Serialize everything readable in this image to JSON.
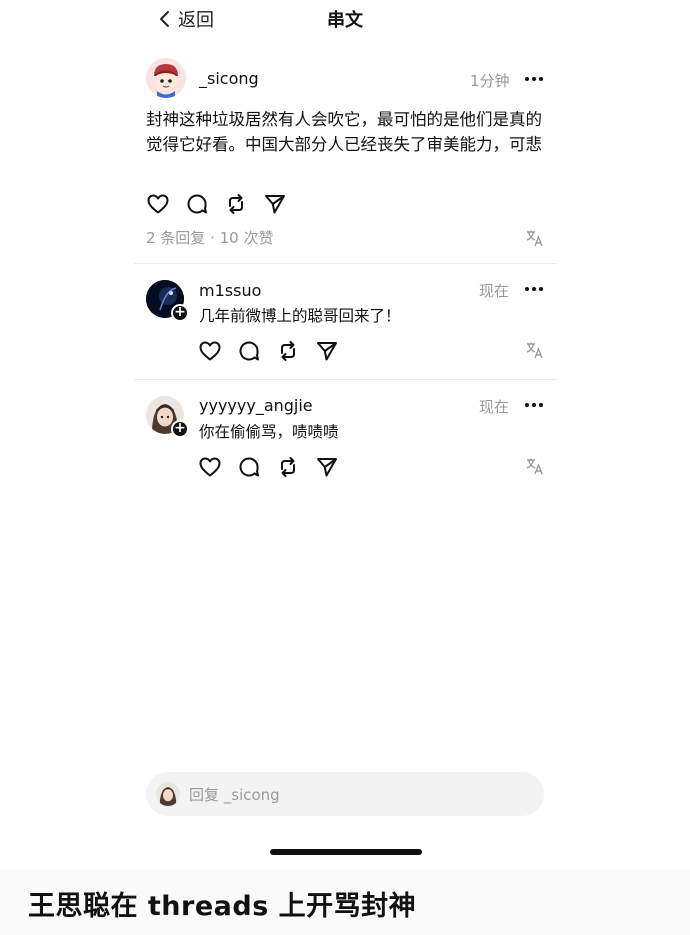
{
  "nav": {
    "back_label": "返回",
    "title": "串文"
  },
  "post": {
    "username": "_sicong",
    "time": "1分钟",
    "text": "封神这种垃圾居然有人会吹它，最可怕的是他们是真的觉得它好看。中国大部分人已经丧失了审美能力，可悲",
    "stats": "2 条回复 · 10 次赞"
  },
  "replies": [
    {
      "username": "m1ssuo",
      "time": "现在",
      "text": "几年前微博上的聪哥回来了！"
    },
    {
      "username": "yyyyyy_angjie",
      "time": "现在",
      "text": "你在偷偷骂，啧啧啧"
    }
  ],
  "composer": {
    "placeholder": "回复 _sicong"
  },
  "caption": "王思聪在 threads 上开骂封神",
  "icons": [
    "chevron-left-icon",
    "heart-icon",
    "comment-icon",
    "repost-icon",
    "send-icon",
    "translate-icon",
    "more-icon",
    "plus-icon"
  ]
}
